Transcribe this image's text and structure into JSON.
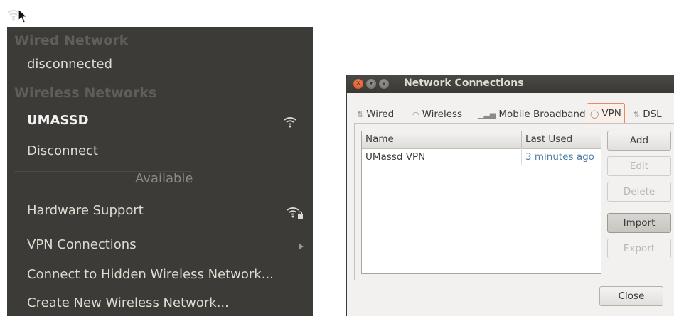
{
  "tray": {
    "icon": "wifi-icon"
  },
  "menu": {
    "wired_header": "Wired Network",
    "wired_status": "disconnected",
    "wireless_header": "Wireless Networks",
    "connected_network": "UMASSD",
    "disconnect": "Disconnect",
    "available": "Available",
    "hardware_support": "Hardware Support",
    "vpn_connections": "VPN Connections",
    "connect_hidden": "Connect to Hidden Wireless Network...",
    "create_new": "Create New Wireless Network..."
  },
  "window": {
    "title": "Network Connections",
    "tabs": [
      {
        "label": "Wired",
        "icon": "wired-icon"
      },
      {
        "label": "Wireless",
        "icon": "wireless-icon"
      },
      {
        "label": "Mobile Broadband",
        "icon": "signal-bars-icon"
      },
      {
        "label": "VPN",
        "icon": "lock-icon"
      },
      {
        "label": "DSL",
        "icon": "dsl-icon"
      }
    ],
    "active_tab": "VPN",
    "columns": {
      "name": "Name",
      "last_used": "Last Used"
    },
    "rows": [
      {
        "name": "UMassd VPN",
        "last_used": "3 minutes ago"
      }
    ],
    "buttons": {
      "add": "Add",
      "edit": "Edit",
      "delete": "Delete",
      "import": "Import",
      "export": "Export",
      "close": "Close"
    }
  }
}
